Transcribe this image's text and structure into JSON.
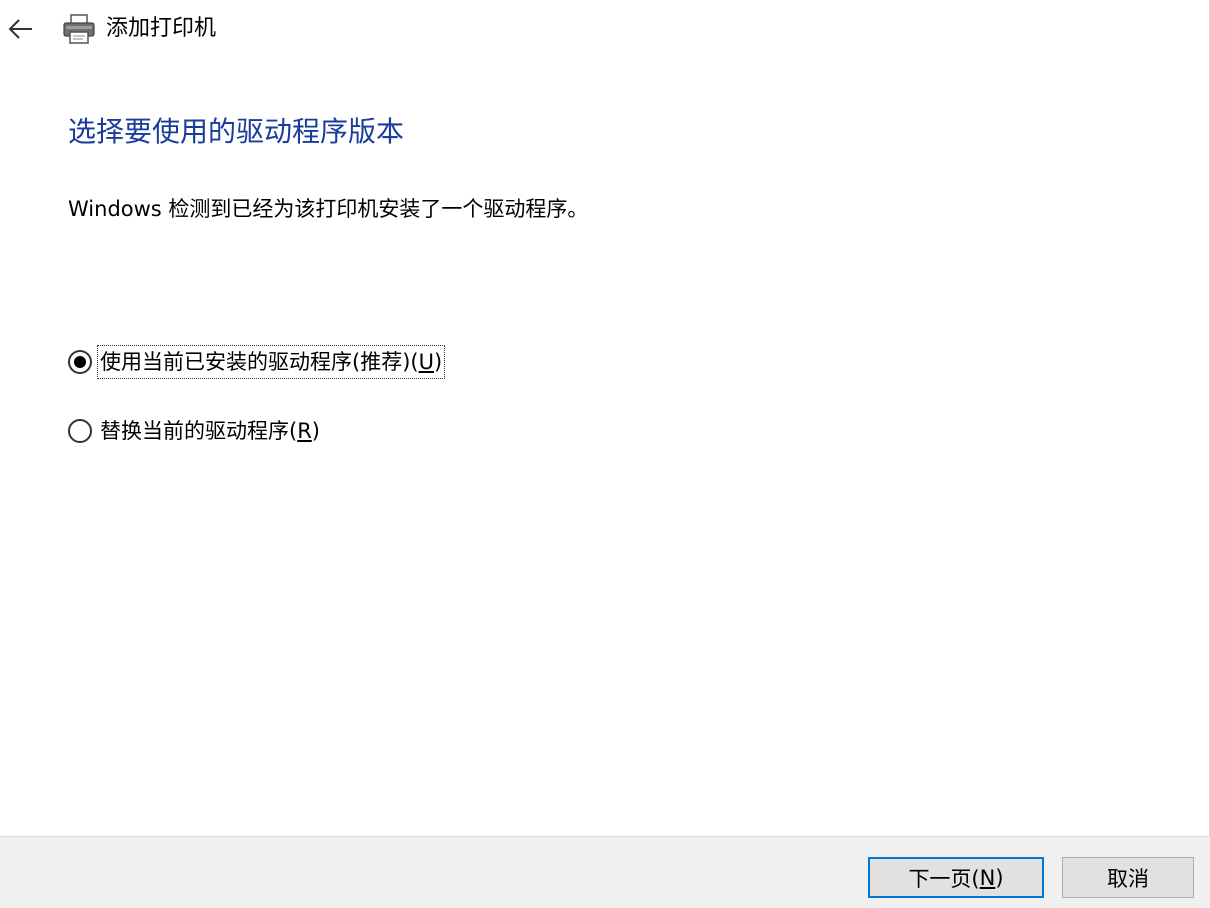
{
  "window": {
    "title": "添加打印机",
    "back_icon": "arrow-left-icon",
    "app_icon": "printer-icon"
  },
  "content": {
    "heading": "选择要使用的驱动程序版本",
    "description": "Windows 检测到已经为该打印机安装了一个驱动程序。",
    "options": [
      {
        "label_prefix": "使用当前已安装的驱动程序(推荐)(",
        "accelerator": "U",
        "label_suffix": ")",
        "selected": true
      },
      {
        "label_prefix": "替换当前的驱动程序(",
        "accelerator": "R",
        "label_suffix": ")",
        "selected": false
      }
    ]
  },
  "footer": {
    "next": {
      "prefix": "下一页(",
      "accelerator": "N",
      "suffix": ")"
    },
    "cancel_label": "取消"
  },
  "colors": {
    "heading": "#1a3c9a",
    "primary_button_border": "#0078d7",
    "footer_background": "#f0f0f0"
  }
}
